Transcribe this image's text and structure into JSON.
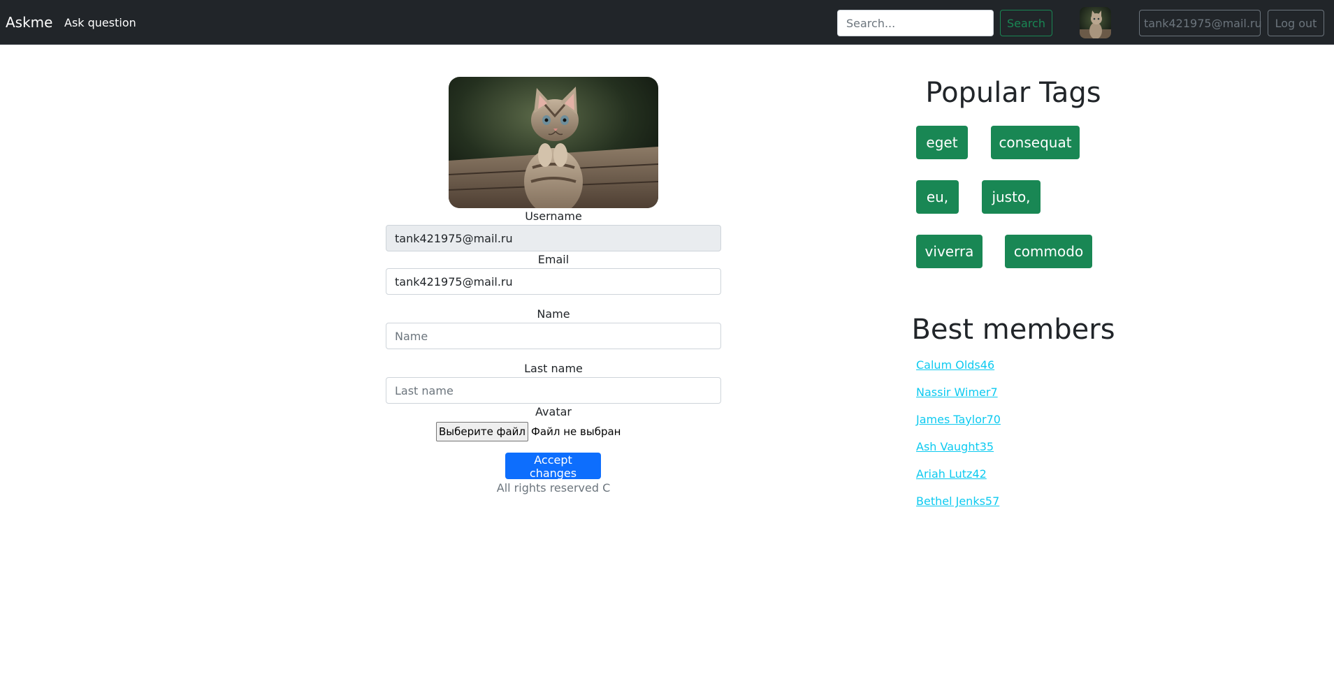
{
  "nav": {
    "brand": "Askme",
    "ask_question": "Ask question",
    "search_placeholder": "Search...",
    "search_button": "Search",
    "user_button": "tank421975@mail.ru",
    "logout_button": "Log out"
  },
  "profile": {
    "username_label": "Username",
    "username_value": "tank421975@mail.ru",
    "email_label": "Email",
    "email_value": "tank421975@mail.ru",
    "name_label": "Name",
    "name_placeholder": "Name",
    "lastname_label": "Last name",
    "lastname_placeholder": "Last name",
    "avatar_label": "Avatar",
    "file_button": "Выберите файл",
    "file_status": "Файл не выбран",
    "accept_button": "Accept changes",
    "footer": "All rights reserved C"
  },
  "sidebar": {
    "tags_title": "Popular Tags",
    "tags": [
      "eget",
      "consequat",
      "eu,",
      "justo,",
      "viverra",
      "commodo"
    ],
    "members_title": "Best members",
    "members": [
      "Calum Olds46",
      "Nassir Wimer7",
      "James Taylor70",
      "Ash Vaught35",
      "Ariah Lutz42",
      "Bethel Jenks57"
    ]
  },
  "colors": {
    "navbar_bg": "#212529",
    "success": "#198754",
    "primary": "#0d6efd",
    "member_link": "#0dcaf0",
    "muted": "#6c757d"
  },
  "icons": {
    "avatar_image": "kitten-photo"
  }
}
